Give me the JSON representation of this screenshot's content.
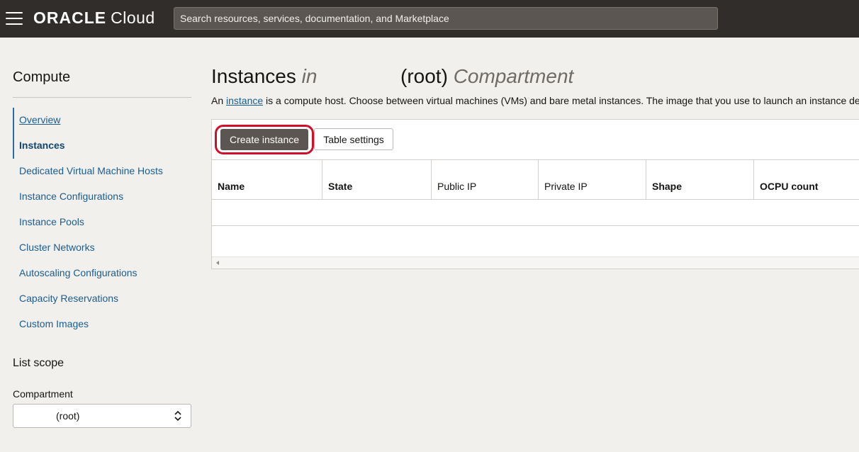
{
  "topbar": {
    "brand_bold": "ORACLE",
    "brand_light": "Cloud",
    "search_placeholder": "Search resources, services, documentation, and Marketplace"
  },
  "sidebar": {
    "title": "Compute",
    "items": [
      {
        "label": "Overview"
      },
      {
        "label": "Instances"
      },
      {
        "label": "Dedicated Virtual Machine Hosts"
      },
      {
        "label": "Instance Configurations"
      },
      {
        "label": "Instance Pools"
      },
      {
        "label": "Cluster Networks"
      },
      {
        "label": "Autoscaling Configurations"
      },
      {
        "label": "Capacity Reservations"
      },
      {
        "label": "Custom Images"
      }
    ],
    "scope_title": "List scope",
    "compartment_label": "Compartment",
    "compartment_value": "(root)"
  },
  "main": {
    "title_part1": "Instances",
    "title_in": "in",
    "title_root": "(root)",
    "title_compartment": "Compartment",
    "desc_prefix": "An ",
    "desc_link": "instance",
    "desc_suffix": " is a compute host. Choose between virtual machines (VMs) and bare metal instances. The image that you use to launch an instance de",
    "create_label": "Create instance",
    "table_settings_label": "Table settings",
    "columns": [
      "Name",
      "State",
      "Public IP",
      "Private IP",
      "Shape",
      "OCPU count"
    ]
  },
  "colors": {
    "topbar": "#312d2a",
    "link": "#195c8e",
    "primary_button": "#5b5651",
    "highlight": "#d0102a"
  }
}
